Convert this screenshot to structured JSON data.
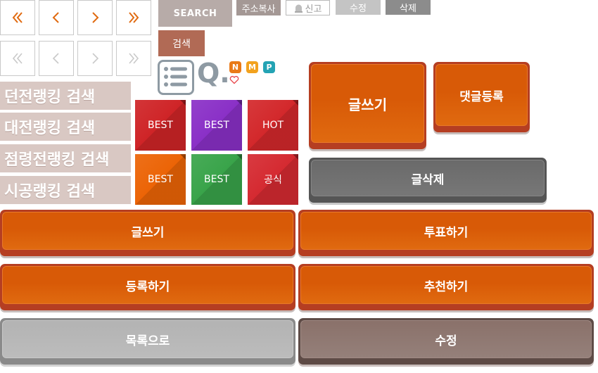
{
  "pagination": {
    "active": {
      "first": "«",
      "prev": "‹",
      "next": "›",
      "last": "»",
      "color": "#e06a10"
    },
    "inactive": {
      "first": "«",
      "prev": "‹",
      "next": "›",
      "last": "»",
      "color": "#c9c9c9"
    }
  },
  "toolbar": {
    "search_label": "SEARCH",
    "gsearch_label": "검색",
    "copy_address_label": "주소복사",
    "report_label": "신고",
    "edit_label": "수정",
    "delete_label": "삭제"
  },
  "icons": {
    "list": "list-icon",
    "quick_search_text": "Q.",
    "badges": [
      {
        "letter": "N",
        "color": "#e97a17"
      },
      {
        "letter": "M",
        "color": "#f2a21e"
      },
      {
        "letter": "P",
        "color": "#24a3b4"
      }
    ],
    "heart": "heart-icon"
  },
  "ranking_searches": [
    "던전랭킹 검색",
    "대전랭킹 검색",
    "점령전랭킹 검색",
    "시공랭킹 검색"
  ],
  "tiles": [
    {
      "label": "BEST",
      "color": "#cf2427"
    },
    {
      "label": "BEST",
      "color": "#8a30c7"
    },
    {
      "label": "HOT",
      "color": "#d3282b"
    },
    {
      "label": "BEST",
      "color": "#ec6406"
    },
    {
      "label": "BEST",
      "color": "#39a44a"
    },
    {
      "label": "공식",
      "color": "#d52a31"
    }
  ],
  "actions": {
    "write": "글쓰기",
    "comment_register": "댓글등록",
    "delete_post": "글삭제",
    "write_wide": "글쓰기",
    "vote": "투표하기",
    "register": "등록하기",
    "recommend": "추천하기",
    "to_list": "목록으로",
    "edit": "수정"
  }
}
